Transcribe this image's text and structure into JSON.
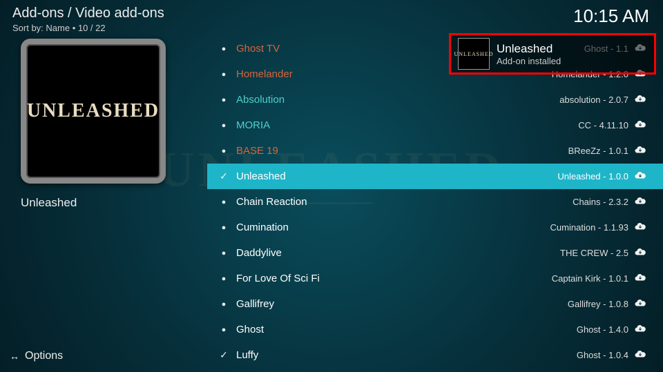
{
  "header": {
    "breadcrumb": "Add-ons / Video add-ons",
    "sort": "Sort by: Name  •  10 / 22",
    "clock": "10:15 AM"
  },
  "sidebar": {
    "thumb_label": "UNLEASHED",
    "item_name": "Unleashed"
  },
  "options_label": "Options",
  "notification": {
    "thumb_label": "UNLEASHED",
    "title": "Unleashed",
    "subtitle": "Add-on installed"
  },
  "list": [
    {
      "title": "Ghost TV",
      "meta": "Ghost - 1.1",
      "color": "orange",
      "installed": false,
      "selected": false
    },
    {
      "title": "Homelander",
      "meta": "Homelander - 1.2.0",
      "color": "orange",
      "installed": false,
      "selected": false
    },
    {
      "title": "Absolution",
      "meta": "absolution - 2.0.7",
      "color": "teal",
      "installed": false,
      "selected": false
    },
    {
      "title": "MORIA",
      "meta": "CC - 4.11.10",
      "color": "teal",
      "installed": false,
      "selected": false
    },
    {
      "title": "BASE 19",
      "meta": "BReeZz - 1.0.1",
      "color": "orange",
      "installed": false,
      "selected": false
    },
    {
      "title": "Unleashed",
      "meta": "Unleashed - 1.0.0",
      "color": "white",
      "installed": true,
      "selected": true
    },
    {
      "title": "Chain Reaction",
      "meta": "Chains - 2.3.2",
      "color": "white",
      "installed": false,
      "selected": false
    },
    {
      "title": "Cumination",
      "meta": "Cumination - 1.1.93",
      "color": "white",
      "installed": false,
      "selected": false
    },
    {
      "title": "Daddylive",
      "meta": "THE CREW - 2.5",
      "color": "white",
      "installed": false,
      "selected": false
    },
    {
      "title": "For Love Of Sci Fi",
      "meta": "Captain Kirk - 1.0.1",
      "color": "white",
      "installed": false,
      "selected": false
    },
    {
      "title": "Gallifrey",
      "meta": "Gallifrey - 1.0.8",
      "color": "white",
      "installed": false,
      "selected": false
    },
    {
      "title": "Ghost",
      "meta": "Ghost - 1.4.0",
      "color": "white",
      "installed": false,
      "selected": false
    },
    {
      "title": "Luffy",
      "meta": "Ghost - 1.0.4",
      "color": "white",
      "installed": true,
      "selected": false
    }
  ]
}
